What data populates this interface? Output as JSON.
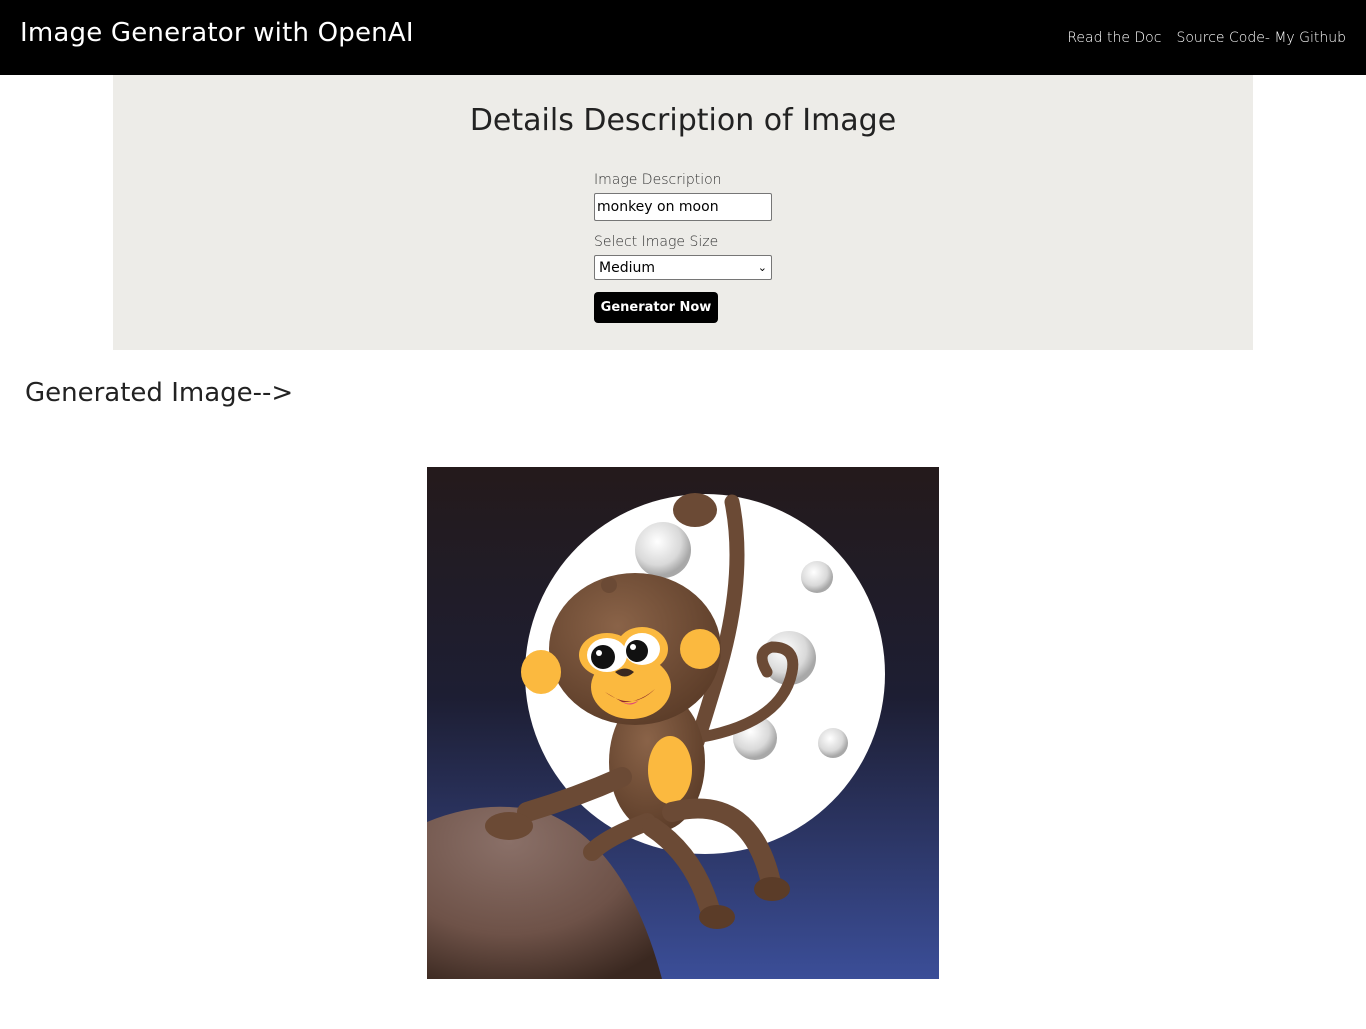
{
  "navbar": {
    "brand": "Image Generator with OpenAI",
    "links": [
      "Read the Doc",
      "Source Code- My Github"
    ]
  },
  "form": {
    "title": "Details Description of Image",
    "description_label": "Image Description",
    "description_value": "monkey on moon",
    "size_label": "Select Image Size",
    "size_selected": "Medium",
    "button_label": "Generator Now"
  },
  "result": {
    "heading": "Generated Image-->"
  },
  "colors": {
    "navbar_bg": "#000000",
    "panel_bg": "#edece8",
    "button_bg": "#000000"
  }
}
